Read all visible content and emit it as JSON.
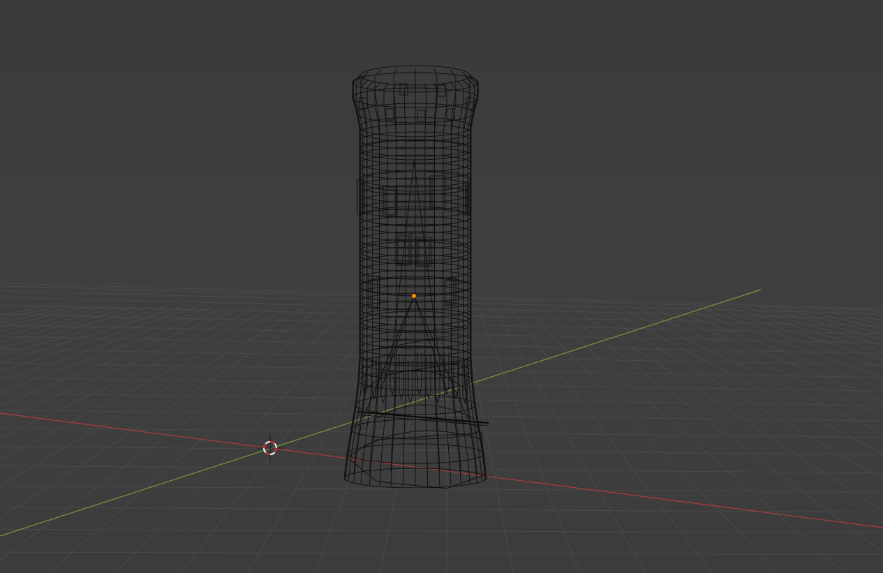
{
  "viewport": {
    "mode": "wireframe",
    "background_color": "#3d3d3d",
    "grid_color": "#4a4a4a",
    "wire_color": "#111111"
  },
  "axes": {
    "x_axis_color": "#b03c3c",
    "y_axis_color": "#7a9a3a"
  },
  "scene_objects": [
    {
      "label": "tower",
      "icon": "tower-wireframe-icon"
    }
  ],
  "origin_point_color": "#ff8c00",
  "cursor": {
    "icon": "3d-cursor-icon",
    "colors": [
      "#ffffff",
      "#cc2222"
    ]
  }
}
